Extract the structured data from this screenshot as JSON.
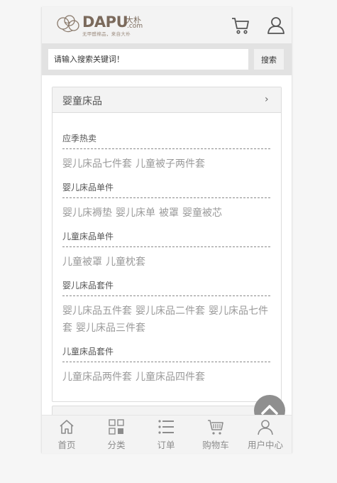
{
  "header": {
    "logo_text": "DAPU",
    "logo_cn": "大朴",
    "logo_suffix": ".com",
    "logo_slogan": "无甲醛棉品，来自大朴"
  },
  "search": {
    "placeholder": "请输入搜索关键词！",
    "button_label": "搜索"
  },
  "category": {
    "title": "婴童床品",
    "groups": [
      {
        "title": "应季热卖",
        "links": [
          "婴儿床品七件套",
          "儿童被子两件套"
        ]
      },
      {
        "title": "婴儿床品单件",
        "links": [
          "婴儿床褥垫",
          "婴儿床单",
          "被罩",
          "婴童被芯"
        ]
      },
      {
        "title": "儿童床品单件",
        "links": [
          "儿童被罩",
          "儿童枕套"
        ]
      },
      {
        "title": "婴儿床品套件",
        "links": [
          "婴儿床品五件套",
          "婴儿床品二件套",
          "婴儿床品七件套",
          "婴儿床品三件套"
        ]
      },
      {
        "title": "儿童床品套件",
        "links": [
          "儿童床品两件套",
          "儿童床品四件套"
        ]
      }
    ]
  },
  "tabbar": {
    "items": [
      {
        "label": "首页",
        "icon": "home-icon"
      },
      {
        "label": "分类",
        "icon": "category-icon"
      },
      {
        "label": "订单",
        "icon": "list-icon"
      },
      {
        "label": "购物车",
        "icon": "cart-icon"
      },
      {
        "label": "用户中心",
        "icon": "user-icon"
      }
    ]
  },
  "colors": {
    "accent": "#7b6a5c",
    "header_bg": "#f3f3f3",
    "search_bg": "#e2e2e2",
    "link": "#9a9a9a",
    "tab_text": "#8c8c8c"
  }
}
